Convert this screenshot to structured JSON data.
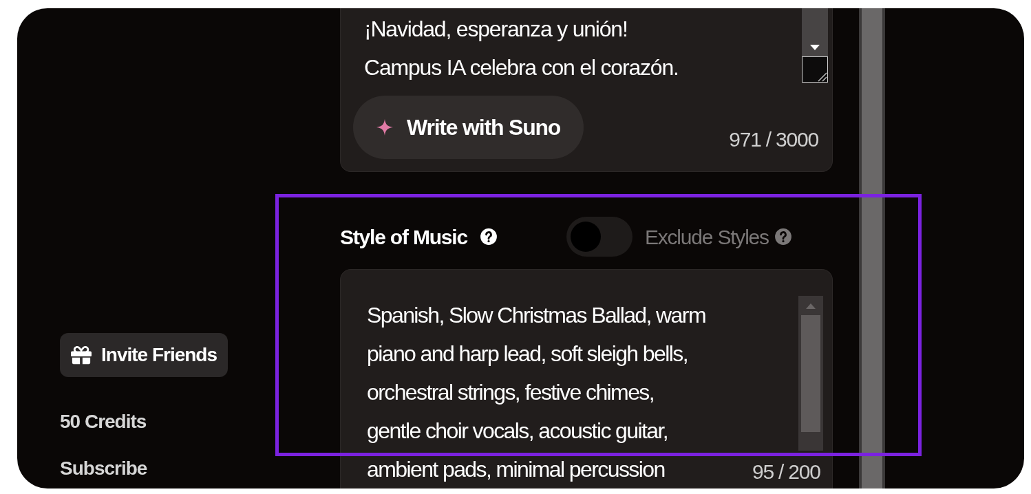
{
  "lyrics": {
    "lines": [
      "¡Navidad, esperanza y unión!",
      "Campus IA celebra con el corazón."
    ],
    "write_button": "Write with Suno",
    "counter": "971 / 3000"
  },
  "sidebar": {
    "invite_button": "Invite Friends",
    "credits": "50 Credits",
    "subscribe": "Subscribe"
  },
  "style": {
    "label": "Style of Music",
    "exclude_toggle": {
      "label": "Exclude Styles",
      "on": false
    },
    "lines": [
      "Spanish, Slow Christmas Ballad, warm",
      "piano and harp lead, soft sleigh bells,",
      "orchestral strings, festive chimes,",
      "gentle choir vocals, acoustic guitar,",
      "ambient pads, minimal percussion"
    ],
    "counter": "95 / 200"
  }
}
